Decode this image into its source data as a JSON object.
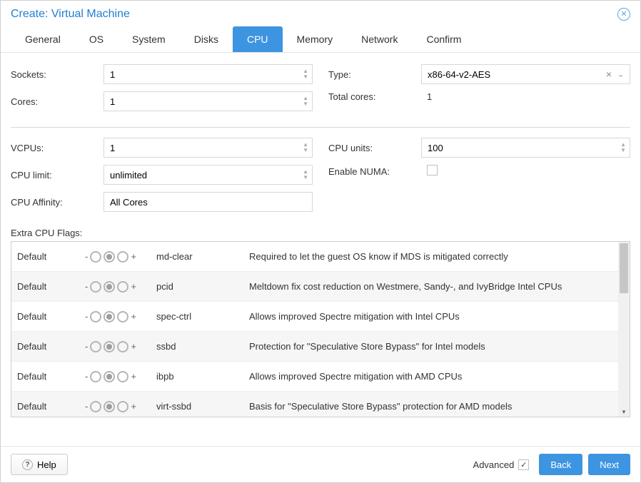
{
  "header": {
    "title": "Create: Virtual Machine"
  },
  "tabs": [
    {
      "label": "General",
      "active": false
    },
    {
      "label": "OS",
      "active": false
    },
    {
      "label": "System",
      "active": false
    },
    {
      "label": "Disks",
      "active": false
    },
    {
      "label": "CPU",
      "active": true
    },
    {
      "label": "Memory",
      "active": false
    },
    {
      "label": "Network",
      "active": false
    },
    {
      "label": "Confirm",
      "active": false
    }
  ],
  "form": {
    "sockets_label": "Sockets:",
    "sockets_value": "1",
    "type_label": "Type:",
    "type_value": "x86-64-v2-AES",
    "cores_label": "Cores:",
    "cores_value": "1",
    "total_cores_label": "Total cores:",
    "total_cores_value": "1",
    "vcpus_label": "VCPUs:",
    "vcpus_value": "1",
    "cpu_units_label": "CPU units:",
    "cpu_units_value": "100",
    "cpu_limit_label": "CPU limit:",
    "cpu_limit_value": "unlimited",
    "enable_numa_label": "Enable NUMA:",
    "enable_numa_checked": false,
    "cpu_affinity_label": "CPU Affinity:",
    "cpu_affinity_value": "All Cores"
  },
  "flags_section_label": "Extra CPU Flags:",
  "flags": [
    {
      "state": "Default",
      "name": "md-clear",
      "desc": "Required to let the guest OS know if MDS is mitigated correctly"
    },
    {
      "state": "Default",
      "name": "pcid",
      "desc": "Meltdown fix cost reduction on Westmere, Sandy-, and IvyBridge Intel CPUs"
    },
    {
      "state": "Default",
      "name": "spec-ctrl",
      "desc": "Allows improved Spectre mitigation with Intel CPUs"
    },
    {
      "state": "Default",
      "name": "ssbd",
      "desc": "Protection for \"Speculative Store Bypass\" for Intel models"
    },
    {
      "state": "Default",
      "name": "ibpb",
      "desc": "Allows improved Spectre mitigation with AMD CPUs"
    },
    {
      "state": "Default",
      "name": "virt-ssbd",
      "desc": "Basis for \"Speculative Store Bypass\" protection for AMD models"
    }
  ],
  "footer": {
    "help_label": "Help",
    "advanced_label": "Advanced",
    "advanced_checked": true,
    "back_label": "Back",
    "next_label": "Next"
  }
}
